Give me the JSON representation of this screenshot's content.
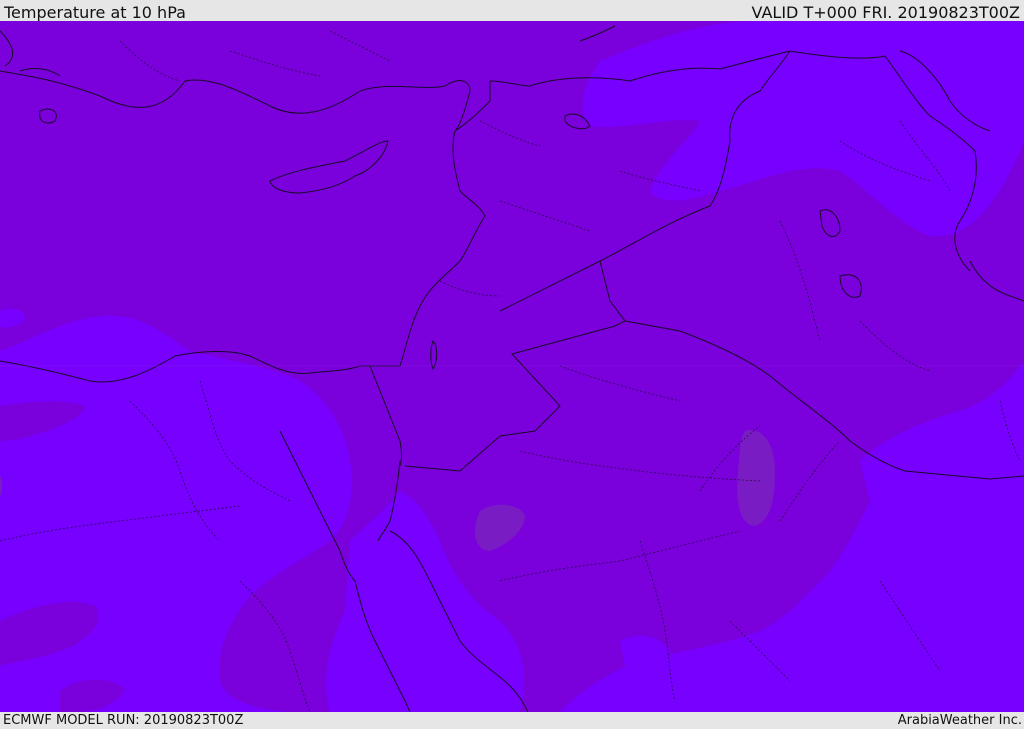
{
  "header": {
    "title": "Temperature at 10 hPa",
    "valid_time": "VALID T+000 FRI. 20190823T00Z"
  },
  "footer": {
    "model_run": "ECMWF MODEL RUN: 20190823T00Z",
    "credit": "ArabiaWeather Inc."
  },
  "map": {
    "colors": {
      "band_dark": "#7a00dc",
      "band_mid": "#7700ff",
      "band_warm": "#7a1cc4",
      "coast": "#1a0a2a",
      "border": "#1a0a2a"
    }
  }
}
